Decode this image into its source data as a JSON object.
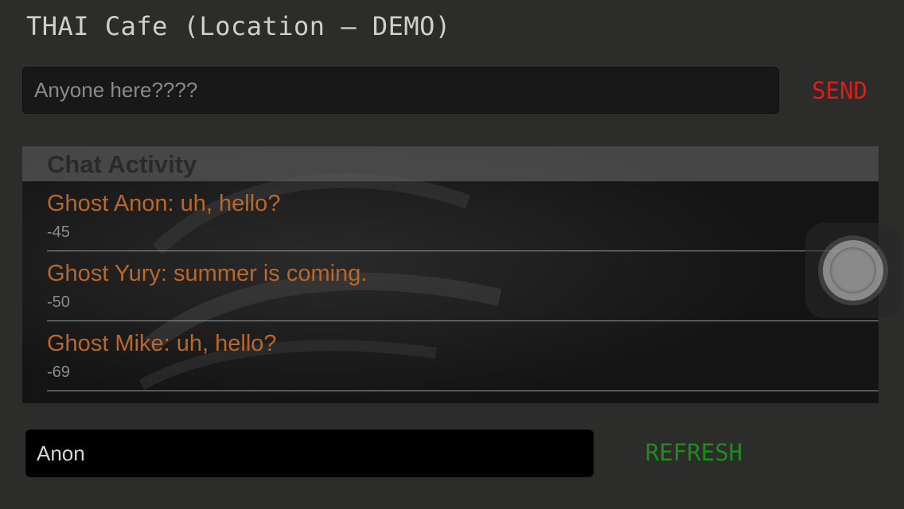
{
  "header": {
    "title": "THAI Cafe (Location – DEMO)"
  },
  "composer": {
    "message_placeholder": "Anyone here????",
    "message_value": "",
    "send_label": "SEND"
  },
  "chat": {
    "header_label": "Chat Activity",
    "messages": [
      {
        "text": "Ghost Anon: uh, hello?",
        "signal": "-45"
      },
      {
        "text": "Ghost Yury: summer is coming.",
        "signal": "-50"
      },
      {
        "text": "Ghost Mike: uh, hello?",
        "signal": "-69"
      }
    ]
  },
  "footer": {
    "name_value": "Anon",
    "refresh_label": "REFRESH"
  },
  "overlay": {
    "icon": "assistive-touch-icon"
  },
  "colors": {
    "background": "#2c2c2b",
    "send": "#e01b1b",
    "refresh": "#1c8c1c",
    "message_text": "#b8682a",
    "signal_text": "#8c8c8c"
  }
}
